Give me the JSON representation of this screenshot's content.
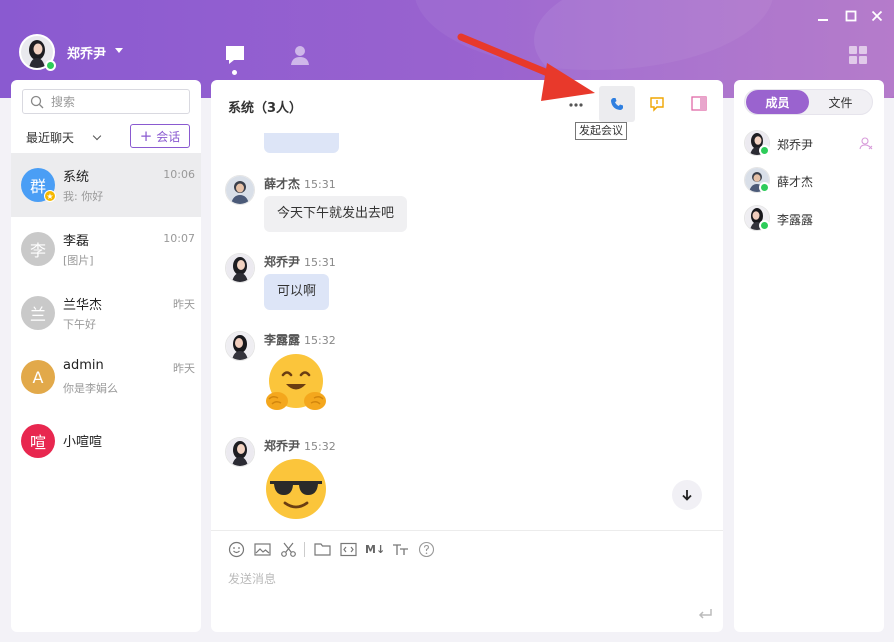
{
  "user": {
    "name": "郑乔尹"
  },
  "nav": {
    "chat_icon": "chat-bubble-icon",
    "contacts_icon": "person-icon"
  },
  "sidebar": {
    "search_placeholder": "搜索",
    "recent_label": "最近聊天",
    "new_chat_label": "会话",
    "conversations": [
      {
        "name": "系统",
        "avatar_text": "群",
        "avatar_color": "#4a9ef5",
        "preview": "我: 你好",
        "time": "10:06",
        "active": true,
        "badge": true
      },
      {
        "name": "李磊",
        "avatar_text": "李",
        "avatar_color": "#c9c9c9",
        "preview": "[图片]",
        "time": "10:07"
      },
      {
        "name": "兰华杰",
        "avatar_text": "兰",
        "avatar_color": "#c9c9c9",
        "preview": "下午好",
        "time": "昨天"
      },
      {
        "name": "admin",
        "avatar_text": "A",
        "avatar_color": "#e2a94a",
        "preview": "你是李娟么",
        "time": "昨天"
      },
      {
        "name": "小喧喧",
        "avatar_text": "喧",
        "avatar_color": "#e8274f",
        "preview": "",
        "time": ""
      }
    ]
  },
  "chat": {
    "title": "系统（3人）",
    "tooltip": "发起会议",
    "messages": [
      {
        "sender": "薛才杰",
        "time": "15:31",
        "text": "今天下午就发出去吧",
        "type": "text",
        "self": false
      },
      {
        "sender": "郑乔尹",
        "time": "15:31",
        "text": "可以啊",
        "type": "text",
        "self": true
      },
      {
        "sender": "李露露",
        "time": "15:32",
        "text": "",
        "type": "emoji-hug",
        "self": false
      },
      {
        "sender": "郑乔尹",
        "time": "15:32",
        "text": "",
        "type": "emoji-sunglasses",
        "self": true
      }
    ],
    "composer": {
      "placeholder": "发送消息",
      "toolbar_icons": [
        "emoji-icon",
        "image-icon",
        "scissors-icon",
        "folder-icon",
        "code-icon",
        "markdown-icon",
        "text-size-icon",
        "help-icon"
      ],
      "markdown_label": "M↓"
    }
  },
  "members": {
    "tabs": [
      "成员",
      "文件"
    ],
    "active_tab": "成员",
    "list": [
      {
        "name": "郑乔尹",
        "owner": true
      },
      {
        "name": "薛才杰",
        "owner": false
      },
      {
        "name": "李露露",
        "owner": false
      }
    ]
  },
  "colors": {
    "accent": "#9a63cf",
    "online": "#2ecc5a",
    "self_bubble": "#dde5f7",
    "other_bubble": "#f0f0f2",
    "arrow": "#e8392b"
  }
}
